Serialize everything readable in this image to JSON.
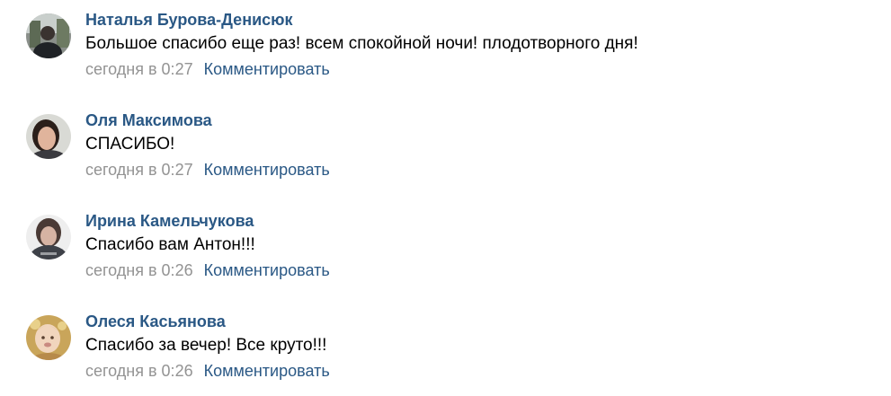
{
  "comments": [
    {
      "author": "Наталья Бурова-Денисюк",
      "text": "Большое спасибо еще раз! всем спокойной ночи! плодотворного дня!",
      "time": "сегодня в 0:27",
      "reply_label": "Комментировать"
    },
    {
      "author": "Оля Максимова",
      "text": "СПАСИБО!",
      "time": "сегодня в 0:27",
      "reply_label": "Комментировать"
    },
    {
      "author": "Ирина Камельчукова",
      "text": "Спасибо вам Антон!!!",
      "time": "сегодня в 0:26",
      "reply_label": "Комментировать"
    },
    {
      "author": "Олеся Касьянова",
      "text": "Спасибо за вечер! Все круто!!!",
      "time": "сегодня в 0:26",
      "reply_label": "Комментировать"
    }
  ],
  "colors": {
    "author": "#2a5885",
    "text": "#000000",
    "meta": "#939393",
    "link": "#2a5885"
  }
}
